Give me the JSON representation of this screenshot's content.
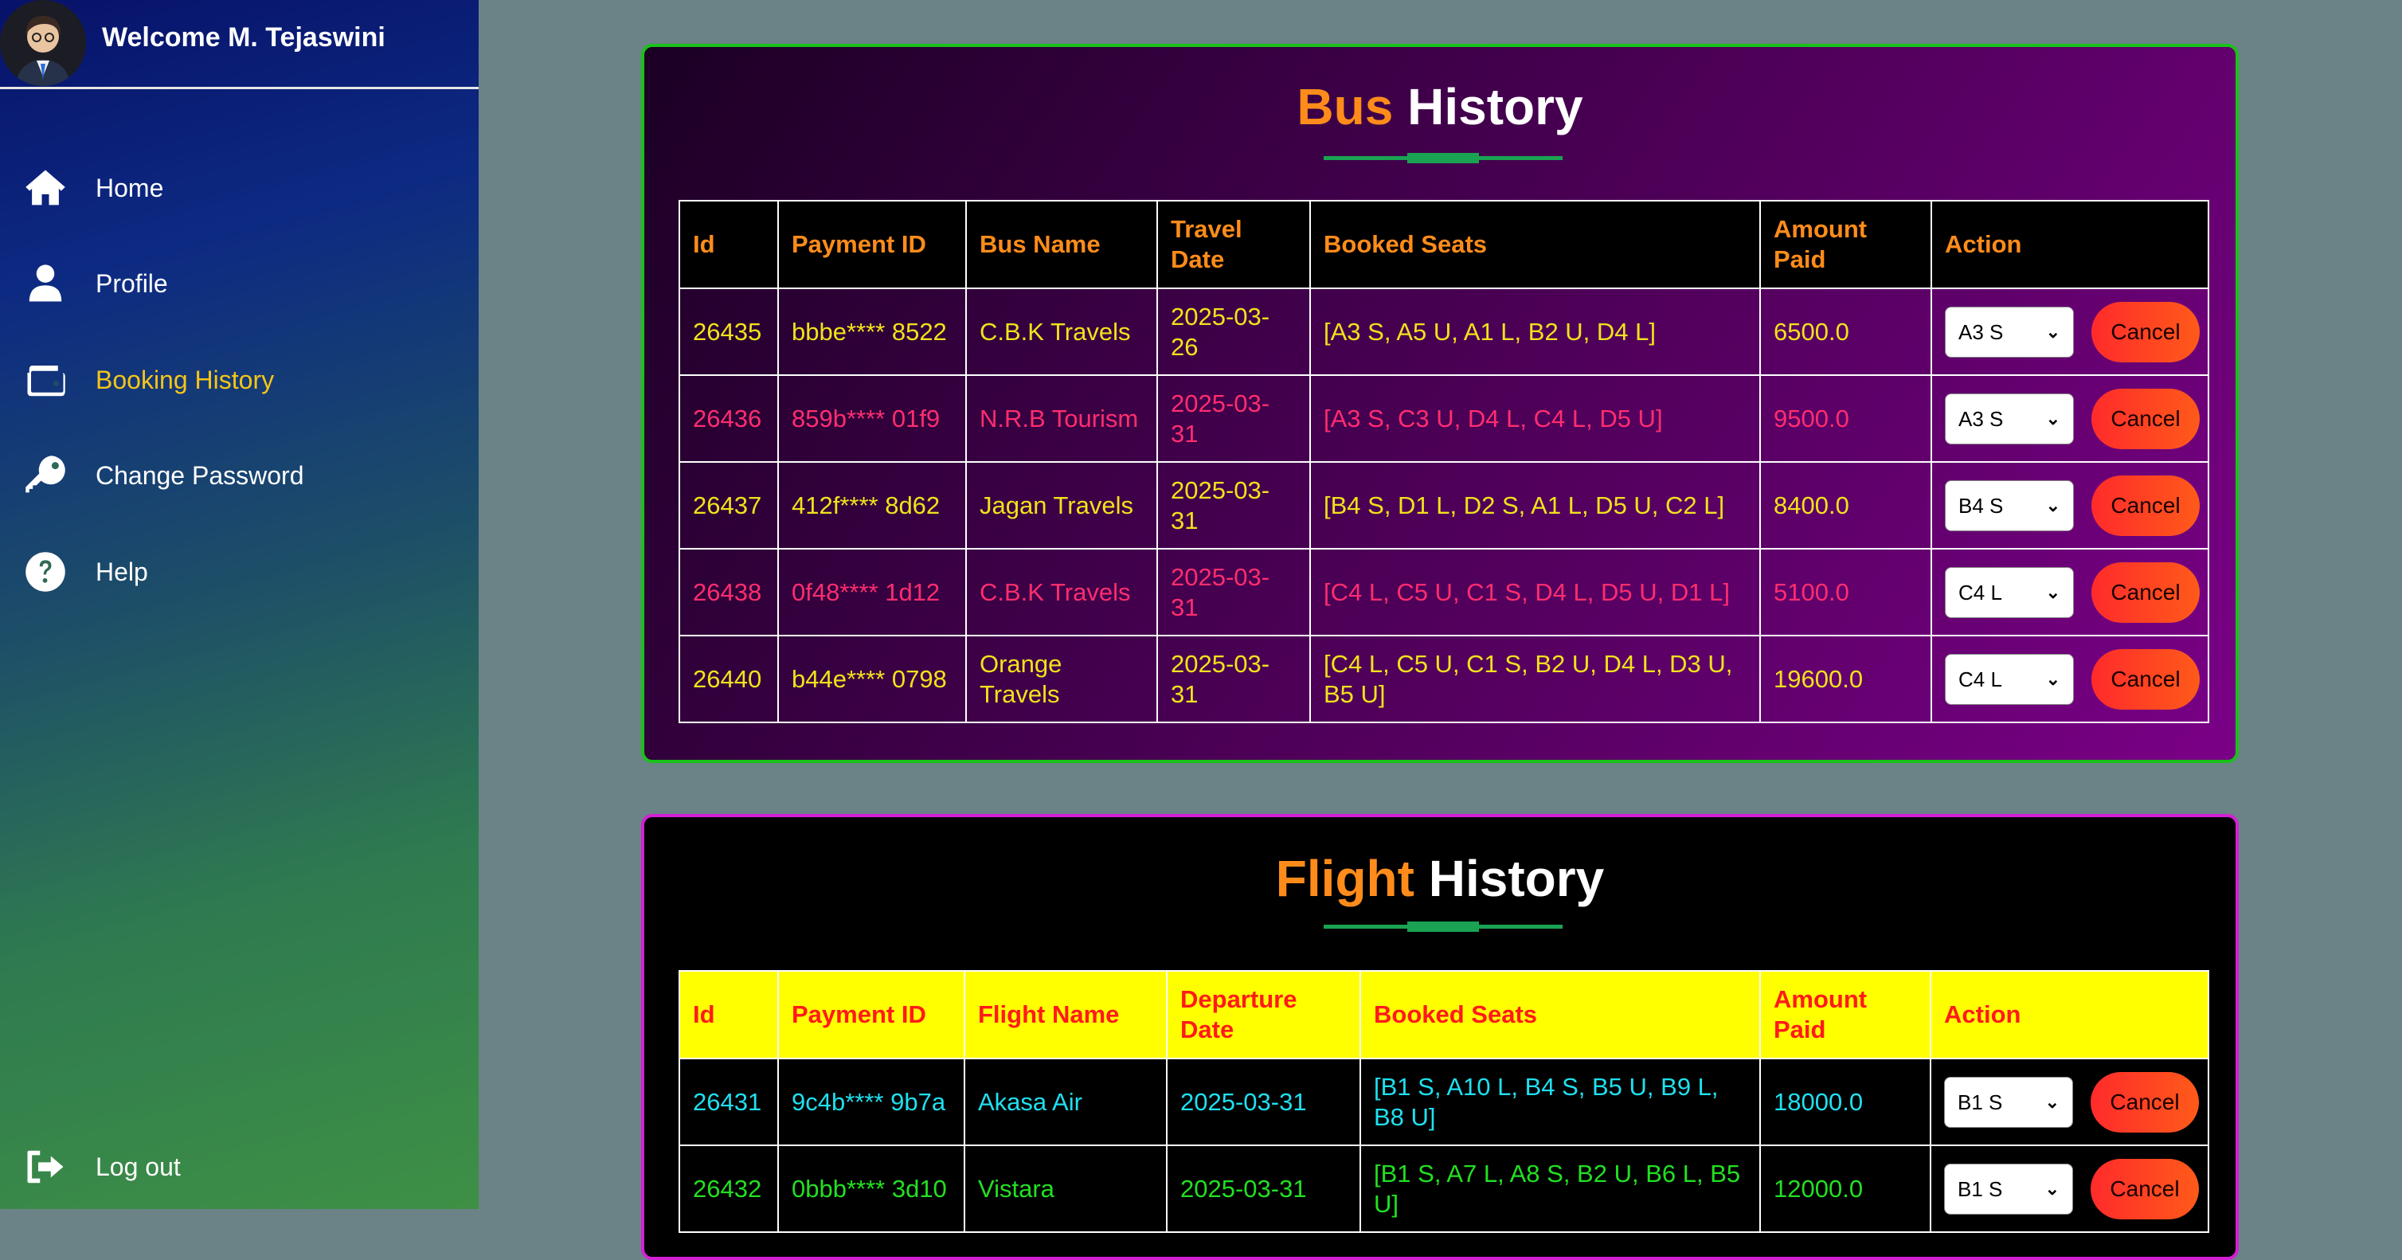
{
  "sidebar": {
    "welcome": "Welcome M. Tejaswini",
    "items": [
      {
        "label": "Home",
        "icon": "home-icon"
      },
      {
        "label": "Profile",
        "icon": "user-icon"
      },
      {
        "label": "Booking History",
        "icon": "wallet-icon",
        "active": true
      },
      {
        "label": "Change Password",
        "icon": "key-icon"
      },
      {
        "label": "Help",
        "icon": "question-icon"
      }
    ],
    "logout": {
      "label": "Log out",
      "icon": "logout-icon"
    }
  },
  "bus": {
    "title_accent": "Bus",
    "title_rest": "History",
    "headers": [
      "Id",
      "Payment ID",
      "Bus Name",
      "Travel Date",
      "Booked Seats",
      "Amount Paid",
      "Action"
    ],
    "rows": [
      {
        "id": "26435",
        "payment": "bbbe**** 8522",
        "name": "C.B.K Travels",
        "date": "2025-03-26",
        "seats": "[A3 S, A5 U, A1 L, B2 U, D4 L]",
        "amount": "6500.0",
        "select": "A3 S"
      },
      {
        "id": "26436",
        "payment": "859b**** 01f9",
        "name": "N.R.B Tourism",
        "date": "2025-03-31",
        "seats": "[A3 S, C3 U, D4 L, C4 L, D5 U]",
        "amount": "9500.0",
        "select": "A3 S"
      },
      {
        "id": "26437",
        "payment": "412f**** 8d62",
        "name": "Jagan Travels",
        "date": "2025-03-31",
        "seats": "[B4 S, D1 L, D2 S, A1 L, D5 U, C2 L]",
        "amount": "8400.0",
        "select": "B4 S"
      },
      {
        "id": "26438",
        "payment": "0f48**** 1d12",
        "name": "C.B.K Travels",
        "date": "2025-03-31",
        "seats": "[C4 L, C5 U, C1 S, D4 L, D5 U, D1 L]",
        "amount": "5100.0",
        "select": "C4 L"
      },
      {
        "id": "26440",
        "payment": "b44e**** 0798",
        "name": "Orange Travels",
        "date": "2025-03-31",
        "seats": "[C4 L, C5 U, C1 S, B2 U, D4 L, D3 U, B5 U]",
        "amount": "19600.0",
        "select": "C4 L"
      }
    ],
    "cancel_label": "Cancel"
  },
  "flight": {
    "title_accent": "Flight",
    "title_rest": "History",
    "headers": [
      "Id",
      "Payment ID",
      "Flight Name",
      "Departure Date",
      "Booked Seats",
      "Amount Paid",
      "Action"
    ],
    "rows": [
      {
        "id": "26431",
        "payment": "9c4b**** 9b7a",
        "name": "Akasa Air",
        "date": "2025-03-31",
        "seats": "[B1 S, A10 L, B4 S, B5 U, B9 L, B8 U]",
        "amount": "18000.0",
        "select": "B1 S"
      },
      {
        "id": "26432",
        "payment": "0bbb**** 3d10",
        "name": "Vistara",
        "date": "2025-03-31",
        "seats": "[B1 S, A7 L, A8 S, B2 U, B6 L, B5 U]",
        "amount": "12000.0",
        "select": "B1 S"
      }
    ],
    "cancel_label": "Cancel"
  }
}
